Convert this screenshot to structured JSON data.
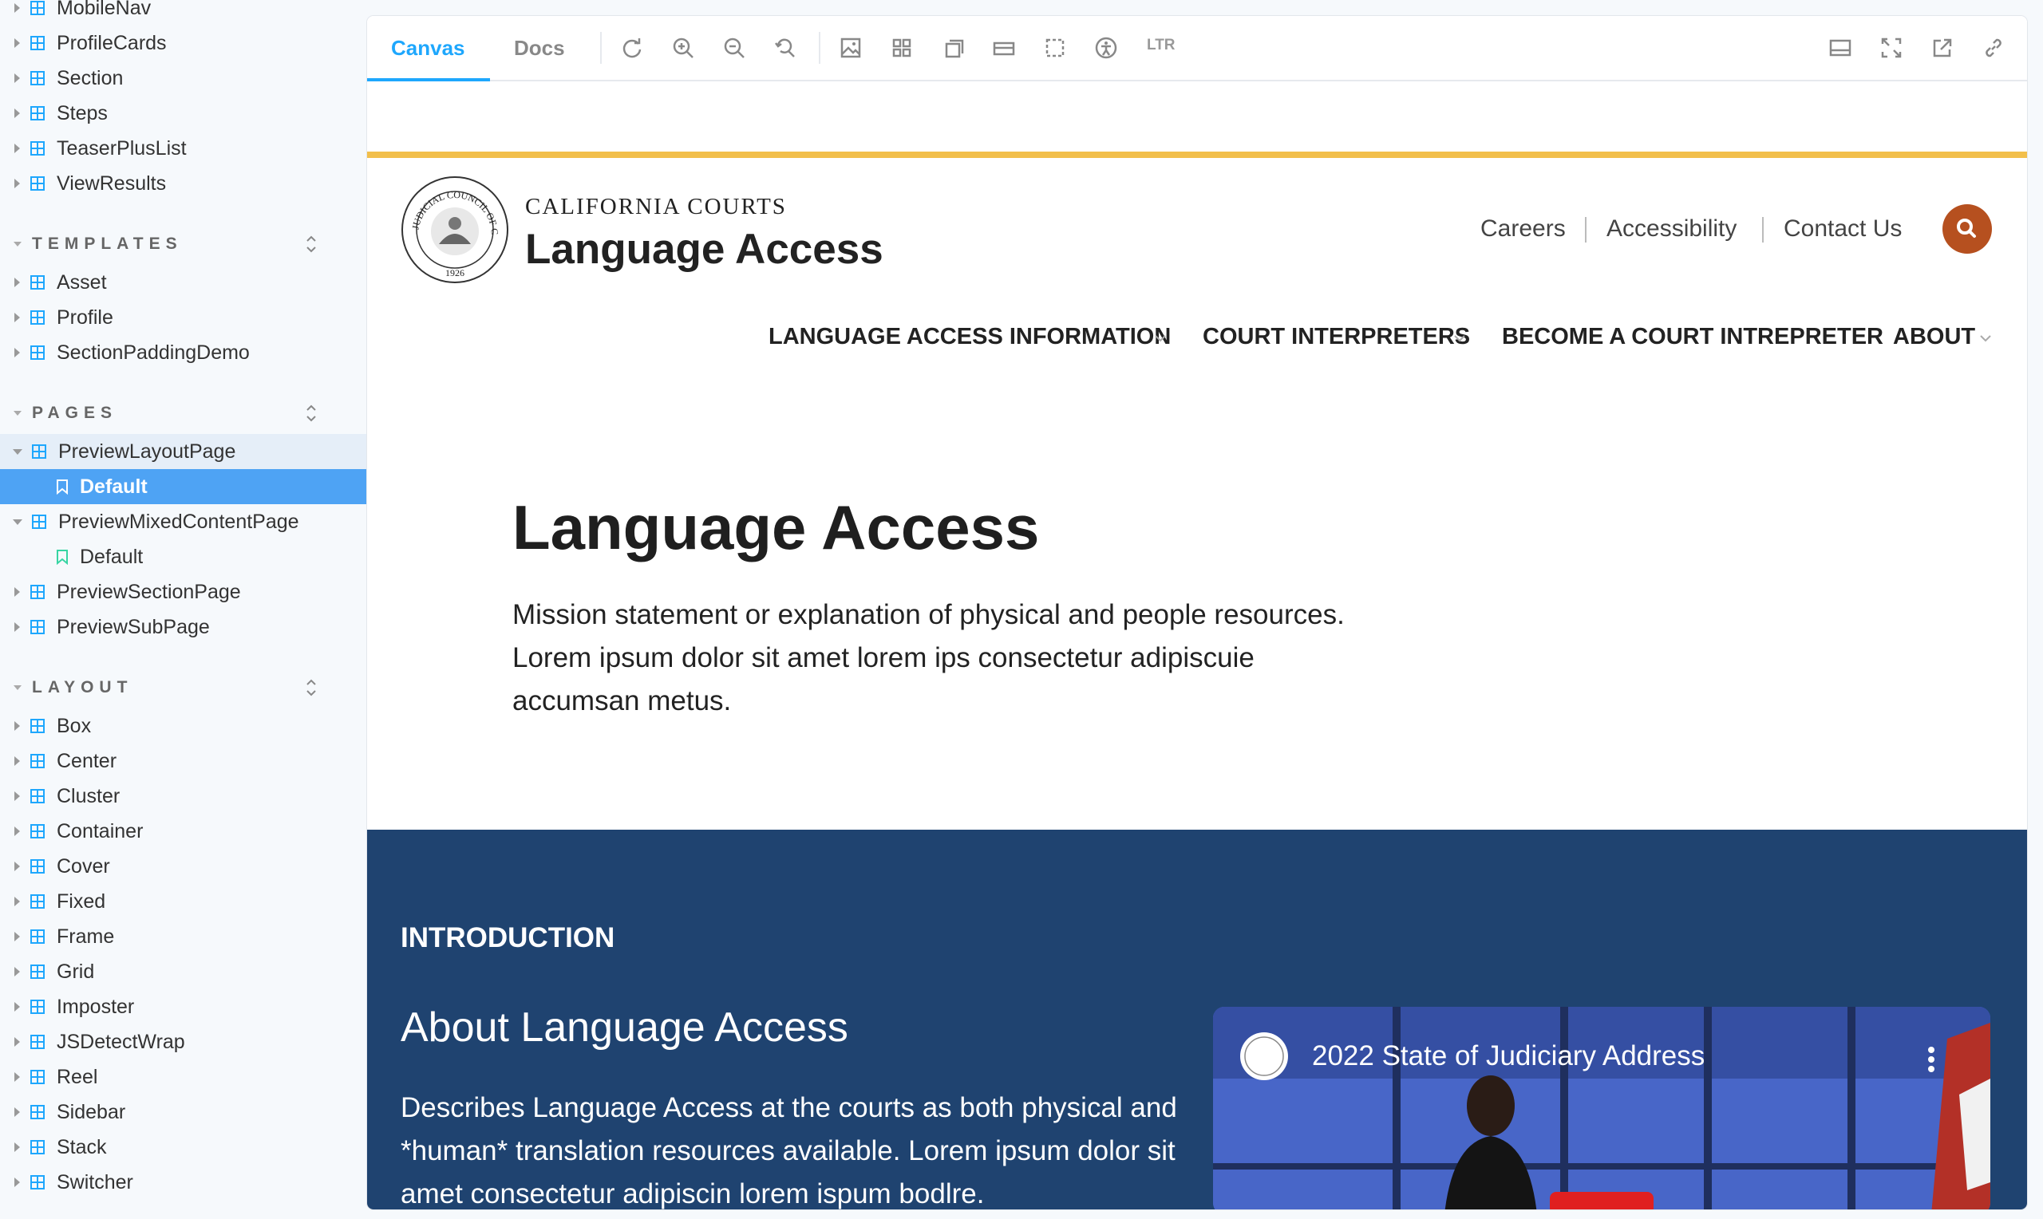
{
  "sidebar": {
    "top_items": [
      {
        "label": "MobileNav"
      },
      {
        "label": "ProfileCards"
      },
      {
        "label": "Section"
      },
      {
        "label": "Steps"
      },
      {
        "label": "TeaserPlusList"
      },
      {
        "label": "ViewResults"
      }
    ],
    "templates": {
      "heading": "TEMPLATES",
      "items": [
        {
          "label": "Asset"
        },
        {
          "label": "Profile"
        },
        {
          "label": "SectionPaddingDemo"
        }
      ]
    },
    "pages": {
      "heading": "PAGES",
      "items": [
        {
          "label": "PreviewLayoutPage",
          "story": "Default"
        },
        {
          "label": "PreviewMixedContentPage",
          "story": "Default"
        },
        {
          "label": "PreviewSectionPage"
        },
        {
          "label": "PreviewSubPage"
        }
      ]
    },
    "layout": {
      "heading": "LAYOUT",
      "items": [
        {
          "label": "Box"
        },
        {
          "label": "Center"
        },
        {
          "label": "Cluster"
        },
        {
          "label": "Container"
        },
        {
          "label": "Cover"
        },
        {
          "label": "Fixed"
        },
        {
          "label": "Frame"
        },
        {
          "label": "Grid"
        },
        {
          "label": "Imposter"
        },
        {
          "label": "JSDetectWrap"
        },
        {
          "label": "Reel"
        },
        {
          "label": "Sidebar"
        },
        {
          "label": "Stack"
        },
        {
          "label": "Switcher"
        }
      ]
    }
  },
  "toolbar": {
    "tab_canvas": "Canvas",
    "tab_docs": "Docs",
    "direction": "LTR",
    "accent": "#1ea7fd"
  },
  "site": {
    "brand_small": "CALIFORNIA COURTS",
    "brand_big": "Language Access",
    "seal_text": "JUDICIAL COUNCIL OF CALIFORNIA",
    "seal_year": "1926",
    "utility_links": [
      "Careers",
      "Accessibility",
      "Contact Us"
    ],
    "nav": [
      "LANGUAGE ACCESS INFORMATION",
      "COURT INTERPRETERS",
      "BECOME A COURT INTREPRETER",
      "ABOUT"
    ],
    "hero_title": "Language Access",
    "hero_text": "Mission statement or explanation of physical and people resources. Lorem ipsum dolor sit amet lorem ips consectetur adipiscuie accumsan metus.",
    "intro_label": "INTRODUCTION",
    "intro_heading": "About Language Access",
    "intro_text": "Describes Language Access at the courts as both physical and *human* translation resources available. Lorem ipsum dolor sit amet consectetur adipiscin lorem ispum bodlre.",
    "video_title": "2022 State of Judiciary Address",
    "colors": {
      "gold": "#f2bf4b",
      "navy": "#1f4370",
      "search": "#b6501f"
    }
  }
}
